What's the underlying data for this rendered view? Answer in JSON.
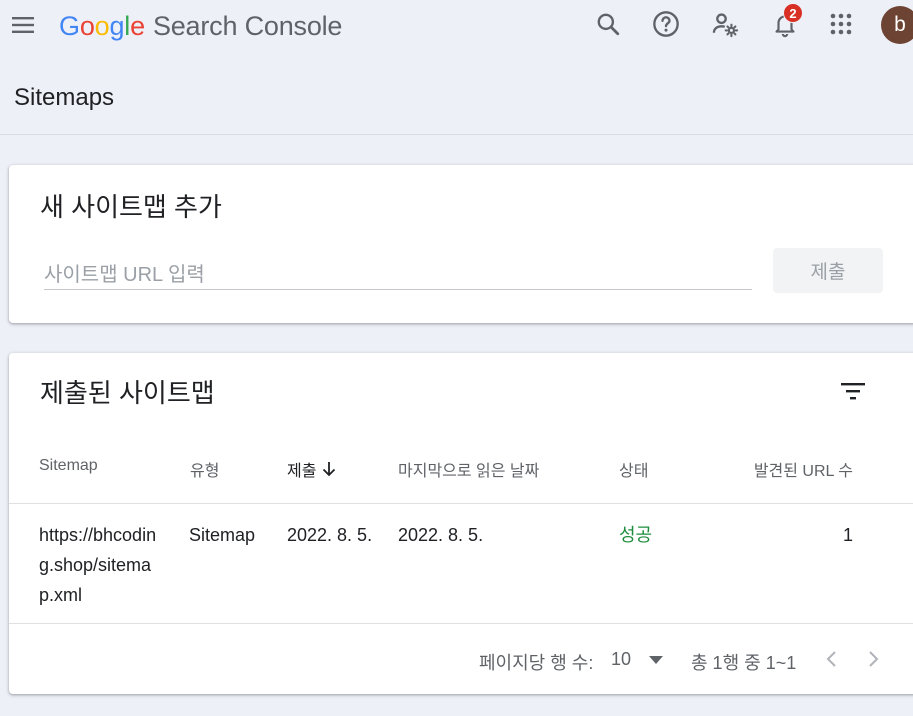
{
  "app": {
    "logo_letters": [
      "G",
      "o",
      "o",
      "g",
      "l",
      "e"
    ],
    "product_name": "Search Console",
    "notification_count": "2",
    "avatar_letter": "b",
    "icons": {
      "menu": "hamburger-menu-icon",
      "search": "search-icon",
      "help": "help-icon",
      "settings": "user-settings-icon",
      "notifications": "bell-icon",
      "apps": "apps-grid-icon"
    }
  },
  "page": {
    "title": "Sitemaps"
  },
  "add_sitemap": {
    "title": "새 사이트맵 추가",
    "input_placeholder": "사이트맵 URL 입력",
    "input_value": "",
    "submit_label": "제출"
  },
  "submitted": {
    "title": "제출된 사이트맵",
    "columns": {
      "sitemap": "Sitemap",
      "type": "유형",
      "submitted": "제출",
      "last_read": "마지막으로 읽은 날짜",
      "status": "상태",
      "discovered_urls": "발견된 URL 수"
    },
    "rows": [
      {
        "sitemap": "https://bhcoding.shop/sitemap.xml",
        "type": "Sitemap",
        "submitted": "2022. 8. 5.",
        "last_read": "2022. 8. 5.",
        "status": "성공",
        "discovered_urls": "1"
      }
    ],
    "pagination": {
      "rows_per_page_label": "페이지당 행 수:",
      "rows_per_page": "10",
      "range_text": "총 1행 중 1~1"
    }
  },
  "colors": {
    "status_success": "#1e8e3e",
    "badge": "#d93025",
    "avatar": "#6d4433",
    "background": "#eef0f8"
  }
}
